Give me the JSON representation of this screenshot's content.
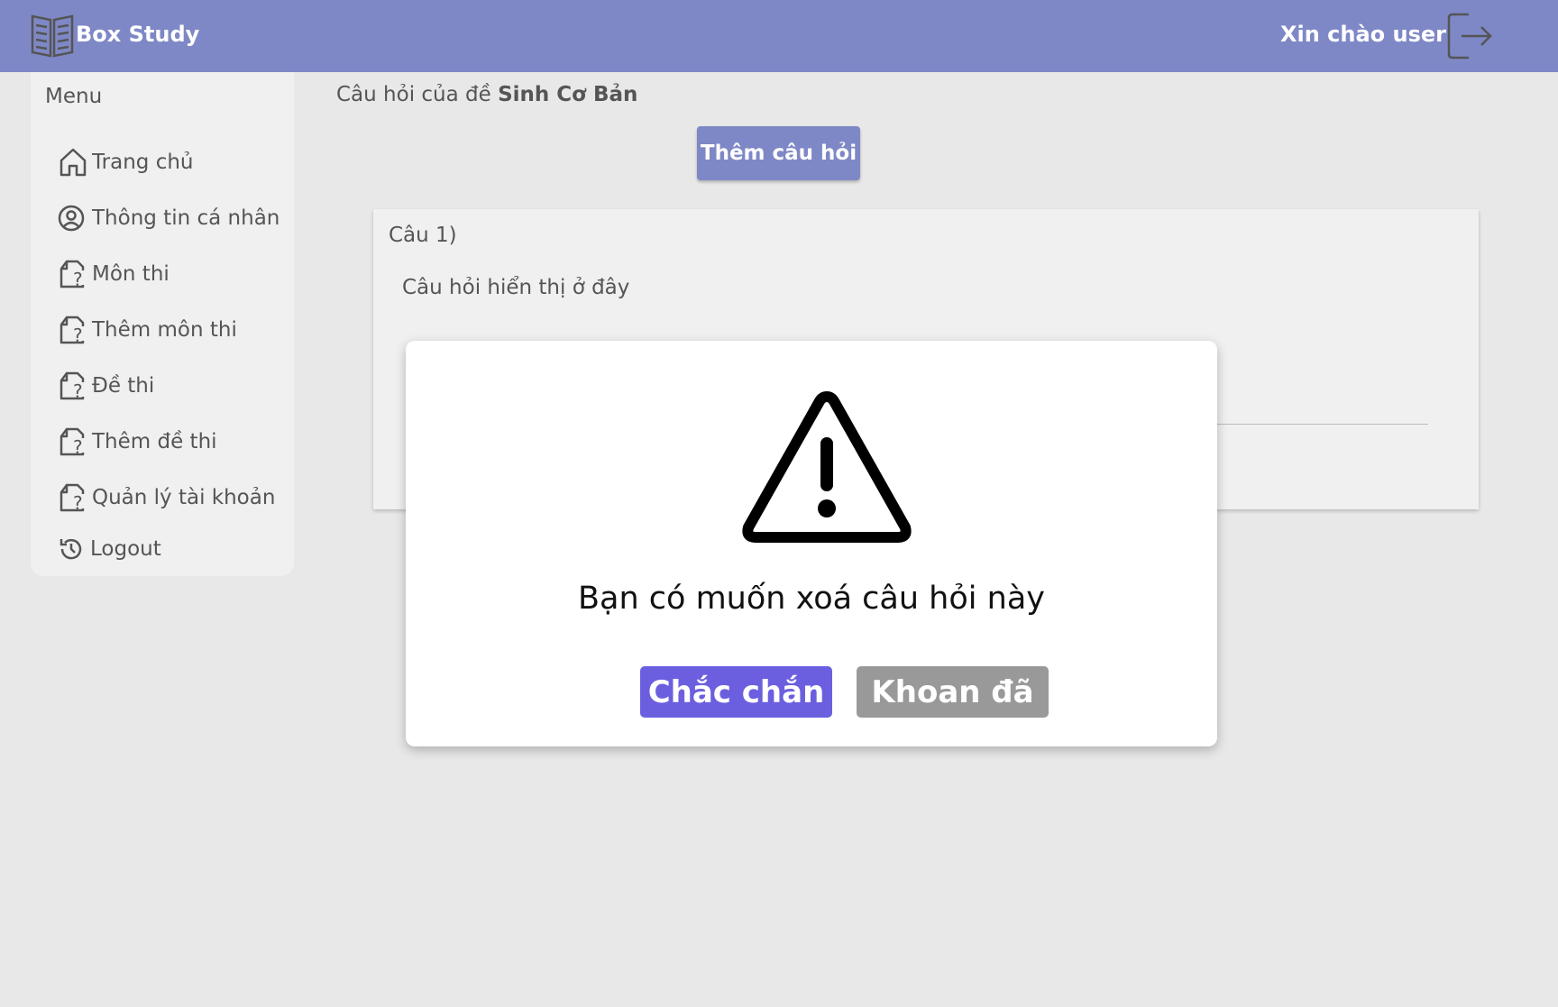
{
  "header": {
    "app_title": "Box Study",
    "greeting": "Xin chào user",
    "brand_color": "#7f88c6",
    "logo_icon": "open-book-icon",
    "logout_icon": "logout-arrow-icon"
  },
  "sidebar": {
    "menu_label": "Menu",
    "items": [
      {
        "label": "Trang chủ",
        "icon": "home-icon"
      },
      {
        "label": "Thông tin cá nhân",
        "icon": "user-circle-icon"
      },
      {
        "label": "Môn thi",
        "icon": "file-question-icon"
      },
      {
        "label": "Thêm môn thi",
        "icon": "file-question-icon"
      },
      {
        "label": "Đề thi",
        "icon": "file-question-icon"
      },
      {
        "label": "Thêm đề thi",
        "icon": "file-question-icon"
      },
      {
        "label": "Quản lý tài khoản",
        "icon": "file-question-icon"
      },
      {
        "label": "Logout",
        "icon": "history-icon"
      }
    ]
  },
  "main": {
    "heading_prefix": "Câu hỏi của đề",
    "exam_name": "Sinh Cơ Bản",
    "add_question_label": "Thêm câu hỏi",
    "questions": [
      {
        "number": "Câu 1)",
        "text": "Câu hỏi hiển thị ở đây"
      }
    ]
  },
  "modal": {
    "icon": "warning-triangle-icon",
    "message": "Bạn có muốn xoá câu hỏi này",
    "confirm_label": "Chắc chắn",
    "cancel_label": "Khoan đã",
    "confirm_color": "#6b5fe0",
    "cancel_color": "#999999"
  }
}
